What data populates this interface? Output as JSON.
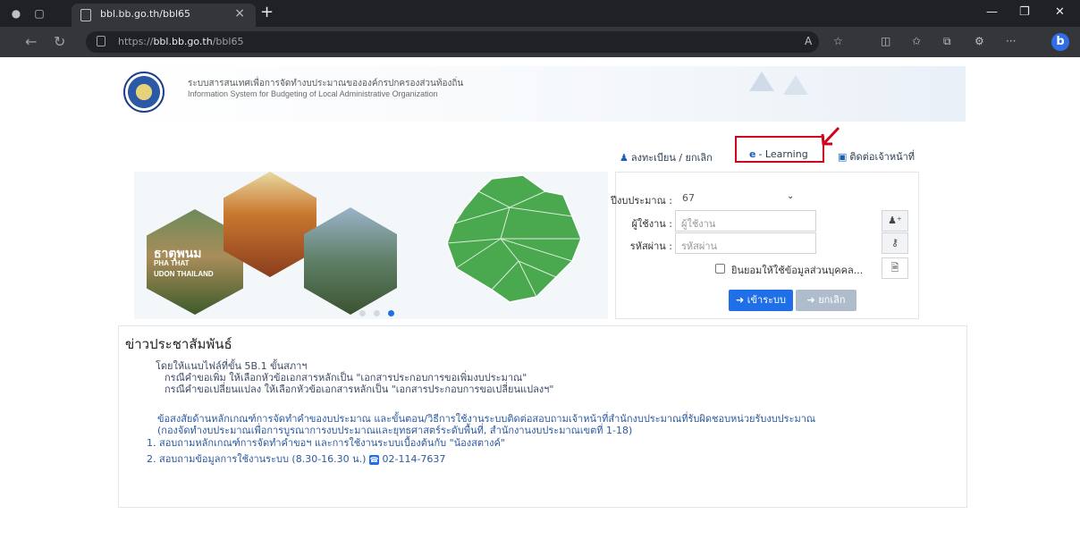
{
  "browser": {
    "tab_title": "bbl.bb.go.th/bbl65",
    "url_prefix": "https://",
    "url_host": "bbl.bb.go.th",
    "url_path": "/bbl65",
    "bing_label": "b"
  },
  "site": {
    "title_th": "ระบบสารสนเทศเพื่อการจัดทำงบประมาณขององค์กรปกครองส่วนท้องถิ่น",
    "title_en": "Information System for Budgeting of Local Administrative Organization"
  },
  "topnav": {
    "register": "ลงทะเบียน / ยกเลิก",
    "elearning": "- Learning",
    "contact": "ติดต่อเจ้าหน้าที่"
  },
  "carousel": {
    "label_1": "ธาตุพนม",
    "label_2": "PHA THAT",
    "label_3": "UDON THAILAND"
  },
  "login": {
    "year_label": "ปีงบประมาณ :",
    "year_value": "67",
    "user_label": "ผู้ใช้งาน :",
    "user_placeholder": "ผู้ใช้งาน",
    "pass_label": "รหัสผ่าน :",
    "pass_placeholder": "รหัสผ่าน",
    "consent_label": "ยินยอมให้ใช้ข้อมูลส่วนบุคคล...",
    "login_button": "เข้าระบบ",
    "cancel_button": "ยกเลิก"
  },
  "news": {
    "title": "ข่าวประชาสัมพันธ์",
    "line1": "โดยให้แนบไฟล์ที่ขั้น 5B.1 ขั้นสภาฯ",
    "line2": "กรณีคำขอเพิ่ม ให้เลือกหัวข้อเอกสารหลักเป็น \"เอกสารประกอบการขอเพิ่มงบประมาณ\"",
    "line3": "กรณีคำขอเปลี่ยนแปลง ให้เลือกหัวข้อเอกสารหลักเป็น \"เอกสารประกอบการขอเปลี่ยนแปลงฯ\"",
    "line4": "ข้อสงสัยด้านหลักเกณฑ์การจัดทำคำของบประมาณ และขั้นตอน/วิธีการใช้งานระบบติดต่อสอบถามเจ้าหน้าที่สำนักงบประมาณที่รับผิดชอบหน่วยรับงบประมาณ",
    "line5": "(กองจัดทำงบประมาณเพื่อการบูรณาการงบประมาณและยุทธศาสตร์ระดับพื้นที่, สำนักงานงบประมาณเขตที่ 1-18)",
    "item1": "1. สอบถามหลักเกณฑ์การจัดทำคำขอฯ และการใช้งานระบบเบื้องต้นกับ \"น้องสตางค์\"",
    "item2": "2. สอบถามข้อมูลการใช้งานระบบ (8.30-16.30 น.)",
    "phone": "02-114-7637"
  }
}
